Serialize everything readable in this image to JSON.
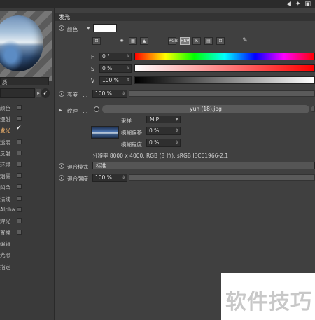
{
  "left": {
    "material_label": "质",
    "channels": [
      {
        "label": "颜色",
        "checked": false,
        "active": false
      },
      {
        "label": "漫射",
        "checked": false,
        "active": false
      },
      {
        "label": "发光",
        "checked": true,
        "active": true
      },
      {
        "label": "透明",
        "checked": false,
        "active": false
      },
      {
        "label": "反射",
        "checked": false,
        "active": false
      },
      {
        "label": "环境",
        "checked": false,
        "active": false
      },
      {
        "label": "烟雾",
        "checked": false,
        "active": false
      },
      {
        "label": "凹凸",
        "checked": false,
        "active": false
      },
      {
        "label": "法线",
        "checked": false,
        "active": false
      },
      {
        "label": "Alpha",
        "checked": false,
        "active": false
      },
      {
        "label": "辉光",
        "checked": false,
        "active": false
      },
      {
        "label": "置换",
        "checked": false,
        "active": false
      },
      {
        "label": "编辑",
        "checked": null,
        "active": false
      },
      {
        "label": "光照",
        "checked": null,
        "active": false
      },
      {
        "label": "指定",
        "checked": null,
        "active": false
      }
    ]
  },
  "main": {
    "section_title": "发光",
    "color_label": "颜色",
    "color_swatch": "#ffffff",
    "hsv_button": "HSV",
    "icon_buttons": [
      "RGB",
      "HSV",
      "K"
    ],
    "h": {
      "label": "H",
      "value": "0 °"
    },
    "s": {
      "label": "S",
      "value": "0 %"
    },
    "v": {
      "label": "V",
      "value": "100 %"
    },
    "brightness": {
      "label": "亮度",
      "dots": ". . .",
      "value": "100 %"
    },
    "texture": {
      "label": "纹理",
      "dots": ". . .",
      "file": "yun (18).jpg"
    },
    "sampling": {
      "label": "采样",
      "value": "MIP"
    },
    "blur_offset": {
      "label": "模糊偏移",
      "value": "0 %"
    },
    "blur_degree": {
      "label": "模糊程度",
      "value": "0 %"
    },
    "resolution": "分辨率 8000 x 4000, RGB (8 位), sRGB IEC61966-2.1",
    "mix_mode": {
      "label": "混合模式",
      "value": "标准"
    },
    "mix_strength": {
      "label": "混合强度",
      "value": "100 %"
    }
  },
  "watermark": "软件技巧"
}
